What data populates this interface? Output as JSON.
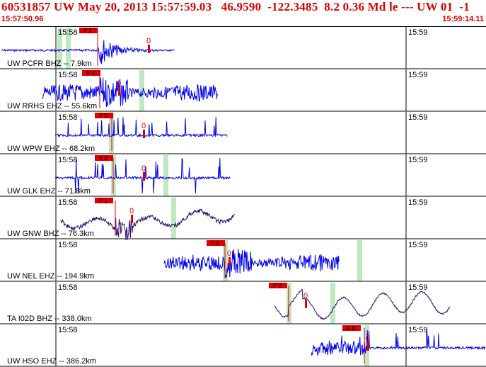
{
  "header": {
    "title": "60531857 UW May 20, 2013 15:57:59.03   46.9590  -122.3485  8.2 0.36 Md le --- UW 01  -1",
    "start_time": "15:57:50.96",
    "end_time": "15:59:14.11"
  },
  "time_ticks": [
    "15:58",
    "15:59"
  ],
  "phase_label": "P",
  "zero_label": "0",
  "colors": {
    "header_text": "#e00000",
    "trace_blue": "#0000ee",
    "trace_purple": "#2a0a6e",
    "pick_red": "#e00000",
    "window_green": "#bfe8bf"
  },
  "traces": [
    {
      "label": "UW PCFR BHZ -- 7.9km",
      "tag": "P 2",
      "color": "blue",
      "style": "burst"
    },
    {
      "label": "UW RRHS EHZ -- 55.6km",
      "tag": "P 0",
      "color": "blue",
      "style": "noise"
    },
    {
      "label": "UW WPW EHZ -- 68.2km",
      "tag": "P 0",
      "color": "blue",
      "style": "spikes"
    },
    {
      "label": "UW GLK EHZ -- 71.8km",
      "tag": "P 0",
      "color": "blue",
      "style": "spikes2"
    },
    {
      "label": "UW GNW BHZ -- 76.3km",
      "tag": "P 1",
      "color": "purple",
      "style": "wavy"
    },
    {
      "label": "UW NEL EHZ -- 194.9km",
      "tag": "P 0",
      "color": "blue",
      "style": "noise"
    },
    {
      "label": "TA I02D BHZ -- 338.0km",
      "tag": "P 2",
      "color": "purple",
      "style": "slow"
    },
    {
      "label": "UW HSO EHZ -- 386.2km",
      "tag": "P 0",
      "color": "blue",
      "style": "spikes3"
    }
  ]
}
